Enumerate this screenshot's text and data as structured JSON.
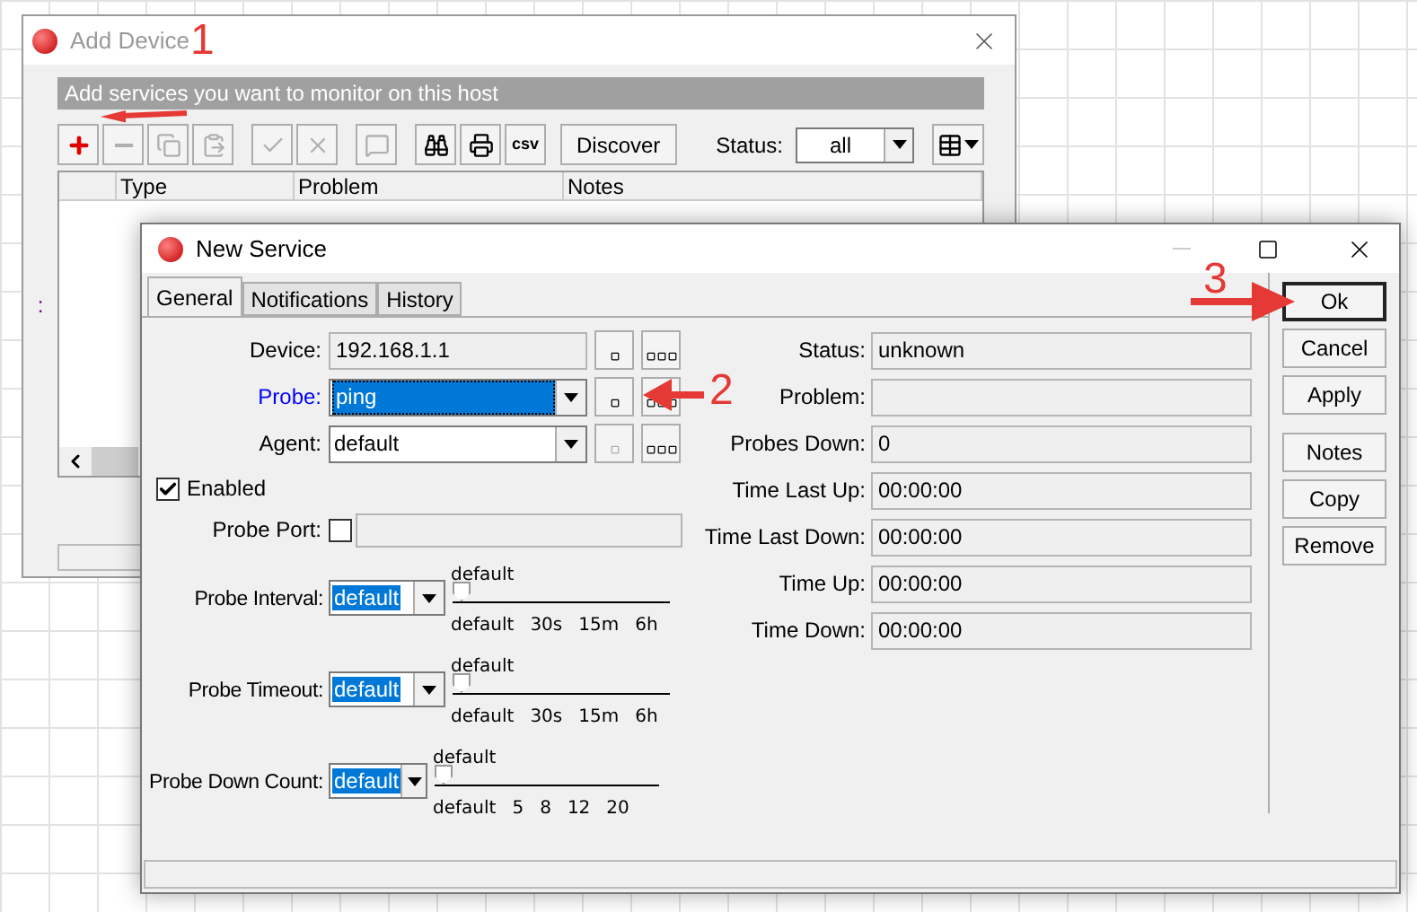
{
  "add_device": {
    "title": "Add Device",
    "banner": "Add services you want to monitor on this host",
    "toolbar": [
      {
        "kind": "add",
        "disabled": false
      },
      {
        "kind": "remove",
        "disabled": true
      },
      {
        "kind": "copy",
        "disabled": true
      },
      {
        "kind": "paste",
        "disabled": true
      },
      {
        "kind": "enable",
        "disabled": true
      },
      {
        "kind": "disable",
        "disabled": true
      },
      {
        "kind": "comment",
        "disabled": true
      },
      {
        "kind": "find",
        "disabled": false
      },
      {
        "kind": "print",
        "disabled": false
      },
      {
        "kind": "csv",
        "label": "csv",
        "disabled": false
      }
    ],
    "discover_button": "Discover",
    "status_label": "Status:",
    "status_value": "all",
    "columns": [
      "Type",
      "Problem",
      "Notes"
    ],
    "marker": ":"
  },
  "new_service": {
    "title": "New Service",
    "tabs": [
      {
        "label": "General",
        "selected": true
      },
      {
        "label": "Notifications",
        "selected": false
      },
      {
        "label": "History",
        "selected": false
      }
    ],
    "device": {
      "label": "Device:",
      "value": "192.168.1.1"
    },
    "probe": {
      "label": "Probe:",
      "value": "ping"
    },
    "agent": {
      "label": "Agent:",
      "value": "default"
    },
    "enabled": {
      "label": "Enabled",
      "checked": true
    },
    "probe_port": {
      "label": "Probe Port:",
      "checked": false
    },
    "sliders": [
      {
        "label": "Probe Interval:",
        "value": "default",
        "reading": "default",
        "level": 0,
        "ticks": [
          "default",
          "30s",
          "15m",
          "6h"
        ]
      },
      {
        "label": "Probe Timeout:",
        "value": "default",
        "reading": "default",
        "level": 0,
        "ticks": [
          "default",
          "30s",
          "15m",
          "6h"
        ]
      },
      {
        "label": "Probe Down Count:",
        "value": "default",
        "reading": "default",
        "level": 0,
        "ticks": [
          "default",
          "5",
          "8",
          "12",
          "20"
        ]
      }
    ],
    "status_fields": [
      {
        "label": "Status:",
        "value": "unknown"
      },
      {
        "label": "Problem:"
      },
      {
        "label": "Probes Down:",
        "value": "0"
      },
      {
        "label": "Time Last Up:",
        "value": "00:00:00"
      },
      {
        "label": "Time Last Down:",
        "value": "00:00:00"
      },
      {
        "label": "Time Up:",
        "value": "00:00:00"
      },
      {
        "label": "Time Down:",
        "value": "00:00:00"
      }
    ],
    "buttons": [
      {
        "label": "Ok",
        "default": true
      },
      {
        "label": "Cancel",
        "default": false
      },
      {
        "label": "Apply",
        "default": false
      },
      {
        "label": "Notes",
        "default": false
      },
      {
        "label": "Copy",
        "default": false
      },
      {
        "label": "Remove",
        "default": false
      }
    ]
  },
  "annotations": [
    "1",
    "2",
    "3"
  ]
}
